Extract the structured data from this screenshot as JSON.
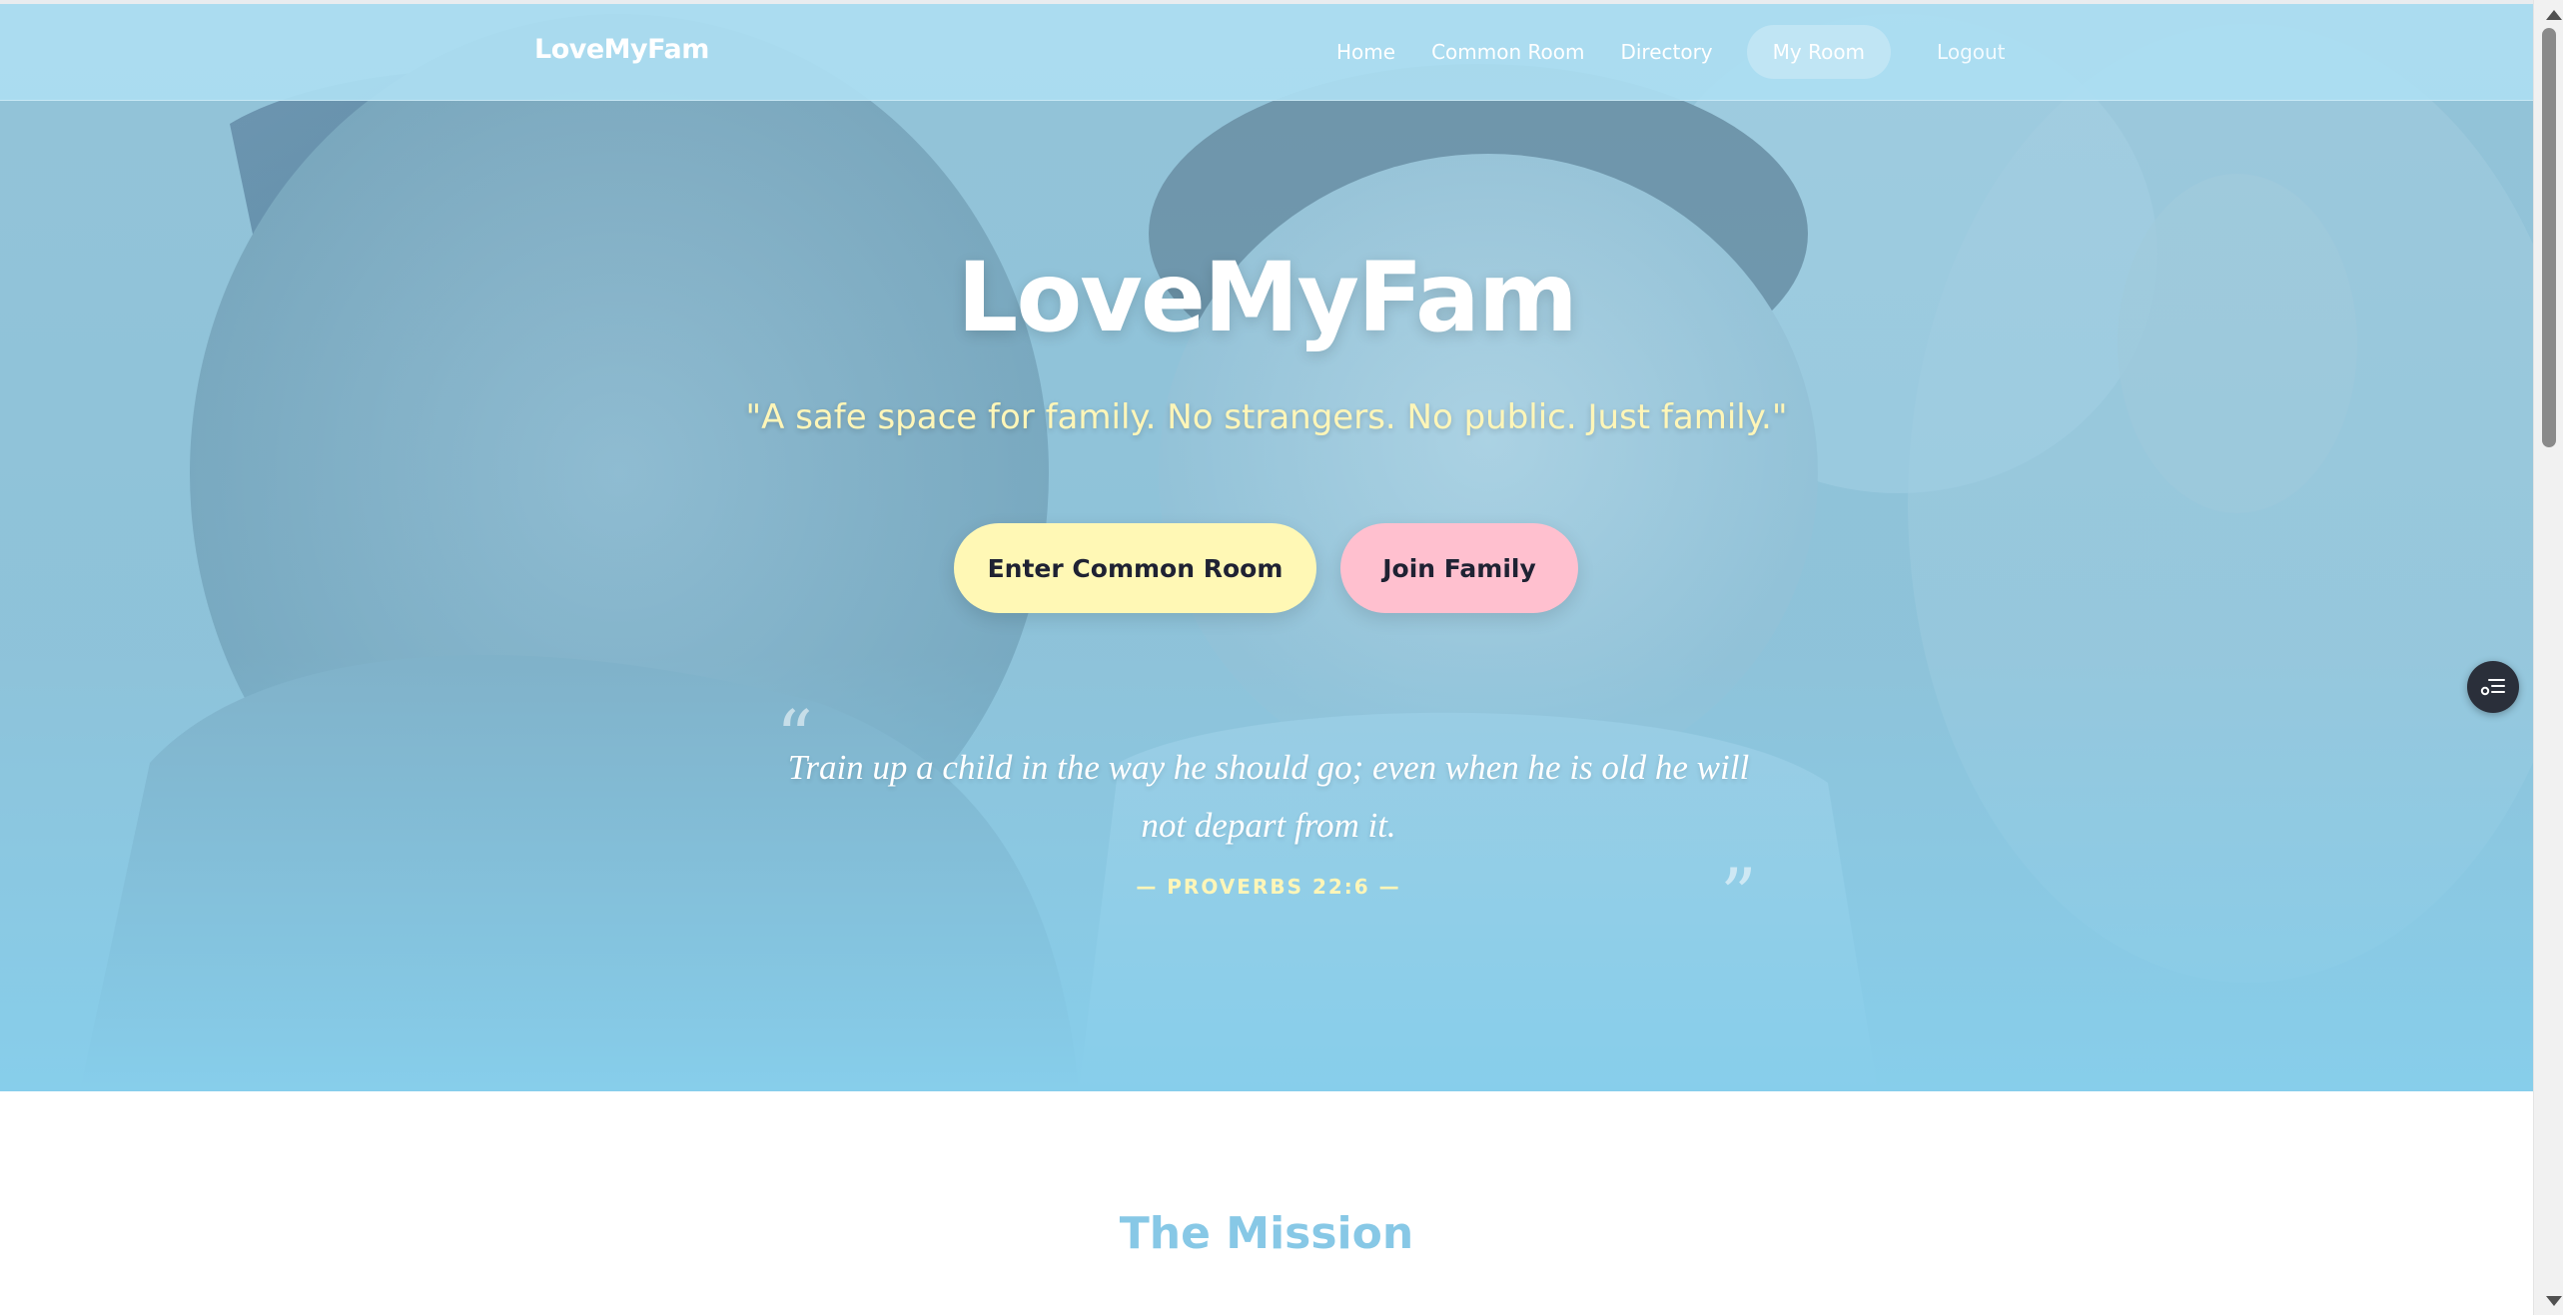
{
  "nav": {
    "brand": "LoveMyFam",
    "links": [
      {
        "label": "Home"
      },
      {
        "label": "Common Room"
      },
      {
        "label": "Directory"
      },
      {
        "label": "My Room",
        "active": true
      },
      {
        "label": "Logout"
      }
    ]
  },
  "hero": {
    "title": "LoveMyFam",
    "tagline": "\"A safe space for family. No strangers. No public. Just family.\"",
    "buttons": {
      "primary": "Enter Common Room",
      "secondary": "Join Family"
    },
    "quote": {
      "open_mark": "“",
      "close_mark": "”",
      "text": "Train up a child in the way he should go; even when he is old he will not depart from it.",
      "reference": "— PROVERBS 22:6 —"
    }
  },
  "mission": {
    "title": "The Mission"
  },
  "icons": {
    "floating_widget": "settings-list-icon"
  },
  "colors": {
    "sky_blue": "#87CEEB",
    "button_yellow": "#FFF8B5",
    "button_pink": "#FFC0CF",
    "tagline_yellow": "#FFF6B8",
    "heading_blue": "#87C8E6"
  }
}
